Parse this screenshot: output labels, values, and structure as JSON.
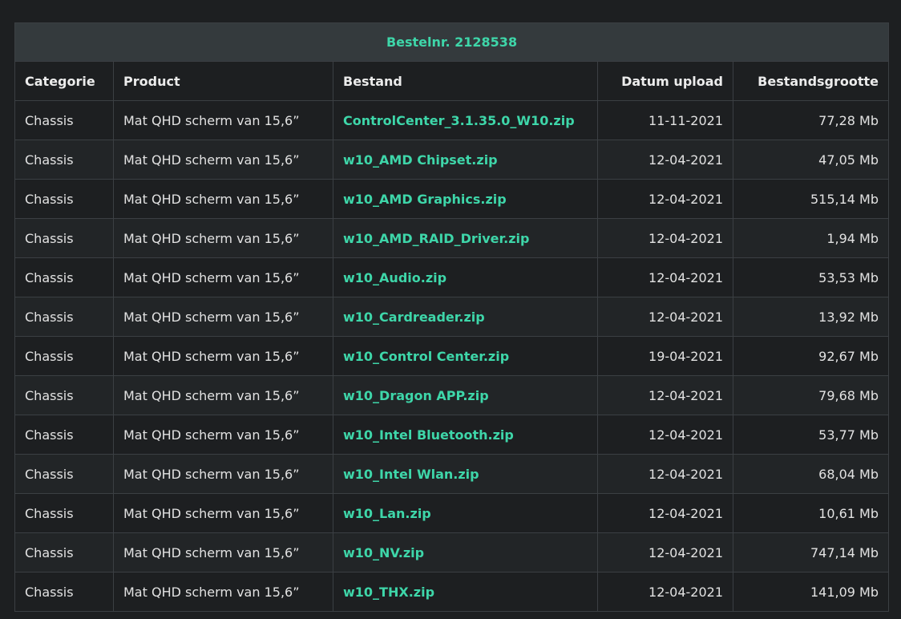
{
  "title": "Bestelnr. 2128538",
  "headers": {
    "category": "Categorie",
    "product": "Product",
    "file": "Bestand",
    "date": "Datum upload",
    "size": "Bestandsgrootte"
  },
  "colors": {
    "accent": "#3ed6a9",
    "background": "#1d1f21",
    "title_bar": "#343a3d"
  },
  "rows": [
    {
      "category": "Chassis",
      "product": "Mat QHD scherm van 15,6”",
      "file": "ControlCenter_3.1.35.0_W10.zip",
      "date": "11-11-2021",
      "size": "77,28 Mb"
    },
    {
      "category": "Chassis",
      "product": "Mat QHD scherm van 15,6”",
      "file": "w10_AMD Chipset.zip",
      "date": "12-04-2021",
      "size": "47,05 Mb"
    },
    {
      "category": "Chassis",
      "product": "Mat QHD scherm van 15,6”",
      "file": "w10_AMD Graphics.zip",
      "date": "12-04-2021",
      "size": "515,14 Mb"
    },
    {
      "category": "Chassis",
      "product": "Mat QHD scherm van 15,6”",
      "file": "w10_AMD_RAID_Driver.zip",
      "date": "12-04-2021",
      "size": "1,94 Mb"
    },
    {
      "category": "Chassis",
      "product": "Mat QHD scherm van 15,6”",
      "file": "w10_Audio.zip",
      "date": "12-04-2021",
      "size": "53,53 Mb"
    },
    {
      "category": "Chassis",
      "product": "Mat QHD scherm van 15,6”",
      "file": "w10_Cardreader.zip",
      "date": "12-04-2021",
      "size": "13,92 Mb"
    },
    {
      "category": "Chassis",
      "product": "Mat QHD scherm van 15,6”",
      "file": "w10_Control Center.zip",
      "date": "19-04-2021",
      "size": "92,67 Mb"
    },
    {
      "category": "Chassis",
      "product": "Mat QHD scherm van 15,6”",
      "file": "w10_Dragon APP.zip",
      "date": "12-04-2021",
      "size": "79,68 Mb"
    },
    {
      "category": "Chassis",
      "product": "Mat QHD scherm van 15,6”",
      "file": "w10_Intel Bluetooth.zip",
      "date": "12-04-2021",
      "size": "53,77 Mb"
    },
    {
      "category": "Chassis",
      "product": "Mat QHD scherm van 15,6”",
      "file": "w10_Intel Wlan.zip",
      "date": "12-04-2021",
      "size": "68,04 Mb"
    },
    {
      "category": "Chassis",
      "product": "Mat QHD scherm van 15,6”",
      "file": "w10_Lan.zip",
      "date": "12-04-2021",
      "size": "10,61 Mb"
    },
    {
      "category": "Chassis",
      "product": "Mat QHD scherm van 15,6”",
      "file": "w10_NV.zip",
      "date": "12-04-2021",
      "size": "747,14 Mb"
    },
    {
      "category": "Chassis",
      "product": "Mat QHD scherm van 15,6”",
      "file": "w10_THX.zip",
      "date": "12-04-2021",
      "size": "141,09 Mb"
    }
  ]
}
